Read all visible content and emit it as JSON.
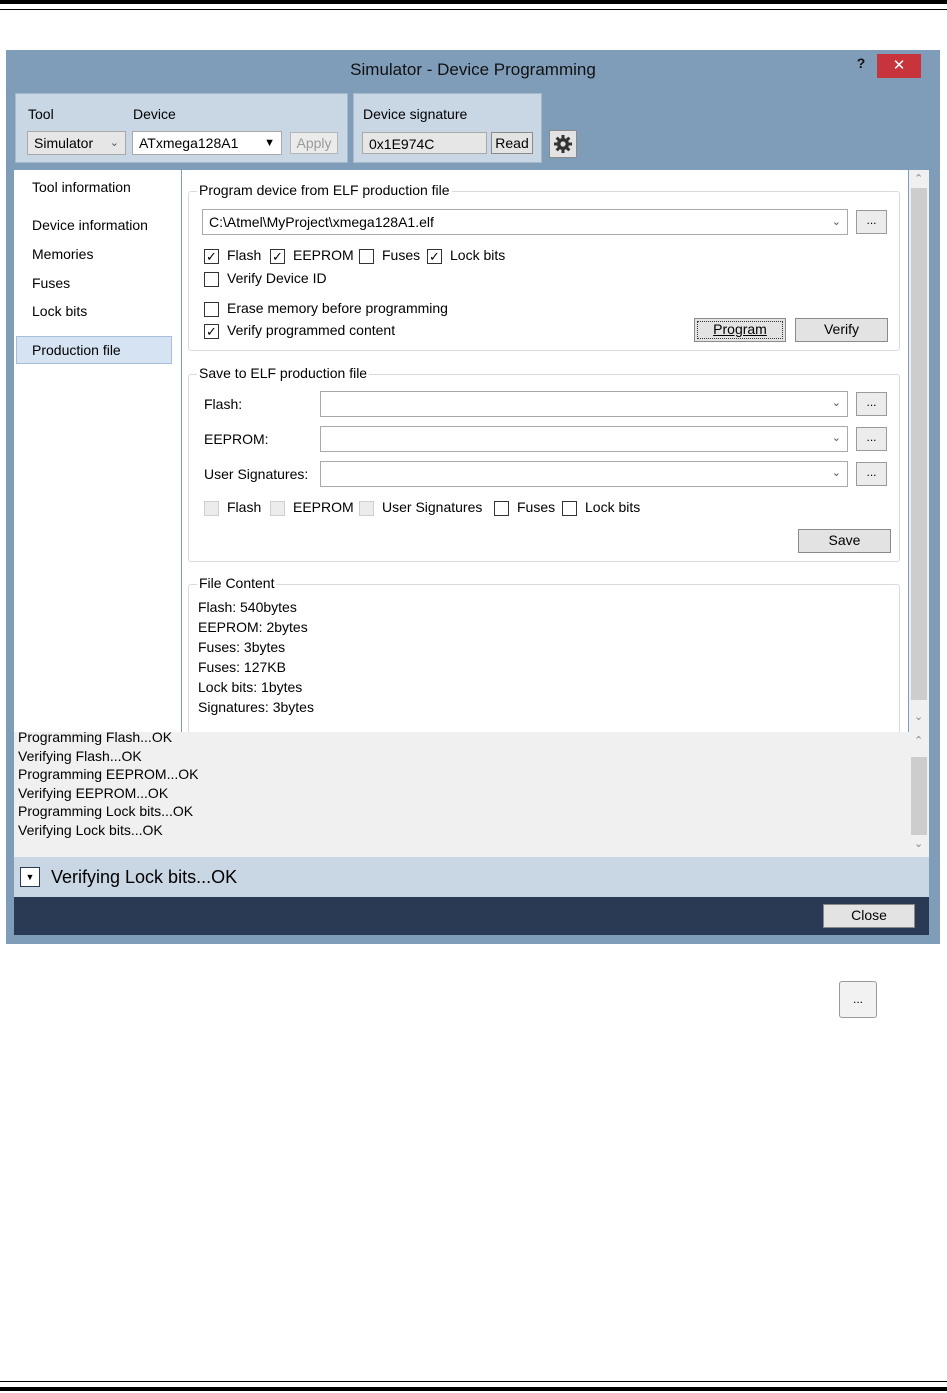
{
  "window": {
    "title": "Simulator - Device Programming",
    "help": "?",
    "close_x": "✕"
  },
  "toolbar": {
    "tool_label": "Tool",
    "device_label": "Device",
    "tool_value": "Simulator",
    "device_value": "ATxmega128A1",
    "apply": "Apply",
    "signature_label": "Device signature",
    "signature_value": "0x1E974C",
    "read": "Read",
    "settings_icon": "gear-icon"
  },
  "sidebar": {
    "items": [
      {
        "label": "Tool information"
      },
      {
        "label": "Device information"
      },
      {
        "label": "Memories"
      },
      {
        "label": "Fuses"
      },
      {
        "label": "Lock bits"
      },
      {
        "label": "Production file"
      }
    ],
    "selected": "Production file"
  },
  "program_group": {
    "legend": "Program device from ELF production file",
    "file_path": "C:\\Atmel\\MyProject\\xmega128A1.elf",
    "browse": "...",
    "checkboxes": [
      {
        "label": "Flash",
        "checked": true
      },
      {
        "label": "EEPROM",
        "checked": true
      },
      {
        "label": "Fuses",
        "checked": false
      },
      {
        "label": "Lock bits",
        "checked": true
      },
      {
        "label": "Verify Device ID",
        "checked": false
      },
      {
        "label": "Erase memory before programming",
        "checked": false
      },
      {
        "label": "Verify programmed content",
        "checked": true
      }
    ],
    "program": "Program",
    "verify": "Verify"
  },
  "save_group": {
    "legend": "Save to ELF production file",
    "fields": [
      {
        "label": "Flash:"
      },
      {
        "label": "EEPROM:"
      },
      {
        "label": "User Signatures:"
      }
    ],
    "browse": "...",
    "checkboxes": [
      {
        "label": "Flash",
        "checked": false,
        "enabled": false
      },
      {
        "label": "EEPROM",
        "checked": false,
        "enabled": false
      },
      {
        "label": "User Signatures",
        "checked": false,
        "enabled": false
      },
      {
        "label": "Fuses",
        "checked": false,
        "enabled": true
      },
      {
        "label": "Lock bits",
        "checked": false,
        "enabled": true
      }
    ],
    "save": "Save"
  },
  "file_content": {
    "legend": "File Content",
    "lines": [
      "Flash: 540bytes",
      "EEPROM: 2bytes",
      "Fuses: 3bytes",
      "Fuses: 127KB",
      "Lock bits: 1bytes",
      "Signatures: 3bytes"
    ]
  },
  "log": {
    "lines": [
      "Programming Flash...OK",
      "Verifying Flash...OK",
      "Programming EEPROM...OK",
      "Verifying EEPROM...OK",
      "Programming Lock bits...OK",
      "Verifying Lock bits...OK"
    ]
  },
  "status": {
    "text": "Verifying Lock bits...OK",
    "expander_icon": "expand-down-icon"
  },
  "footer": {
    "close": "Close"
  },
  "outside": {
    "browse_sample": "..."
  }
}
